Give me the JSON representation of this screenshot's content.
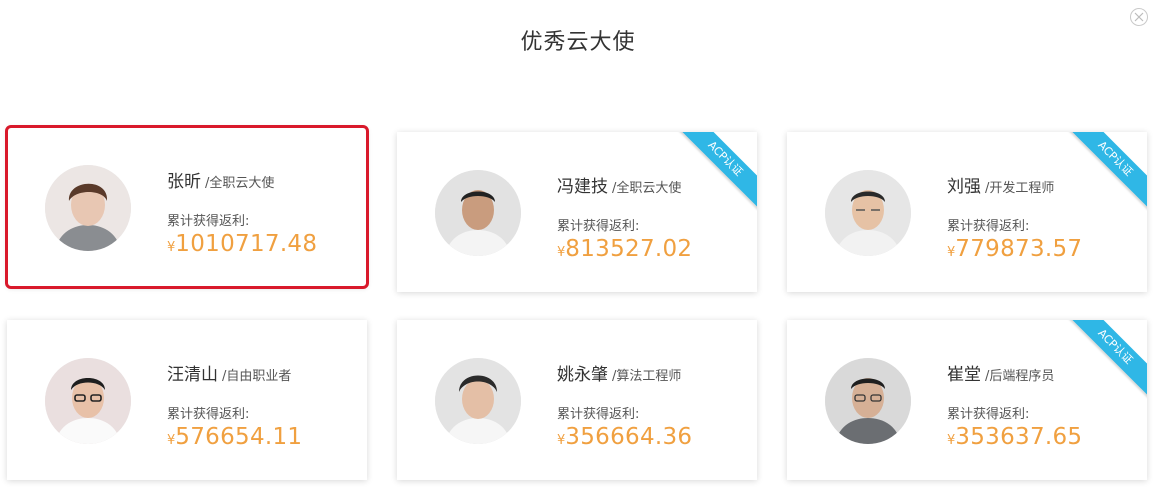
{
  "dialog": {
    "title": "优秀云大使",
    "close_icon": "close-icon"
  },
  "label_text": "累计获得返利:",
  "currency": "¥",
  "ribbon_text": "ACP认证",
  "colors": {
    "amount": "#f0a040",
    "ribbon": "#2fb7e6",
    "selected": "#d9192b"
  },
  "cards": [
    {
      "name": "张昕",
      "role": "/全职云大使",
      "amount": "1010717.48",
      "acp": false,
      "selected": true
    },
    {
      "name": "冯建技",
      "role": "/全职云大使",
      "amount": "813527.02",
      "acp": true,
      "selected": false
    },
    {
      "name": "刘强",
      "role": "/开发工程师",
      "amount": "779873.57",
      "acp": true,
      "selected": false
    },
    {
      "name": "汪清山",
      "role": "/自由职业者",
      "amount": "576654.11",
      "acp": false,
      "selected": false
    },
    {
      "name": "姚永肇",
      "role": "/算法工程师",
      "amount": "356664.36",
      "acp": false,
      "selected": false
    },
    {
      "name": "崔堂",
      "role": "/后端程序员",
      "amount": "353637.65",
      "acp": true,
      "selected": false
    }
  ]
}
